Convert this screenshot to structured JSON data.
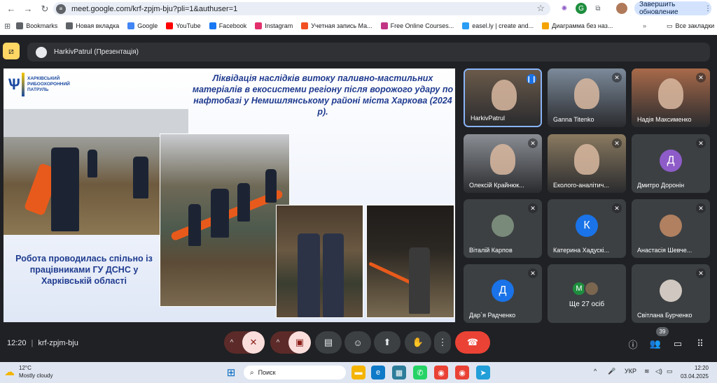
{
  "browser": {
    "url": "meet.google.com/krf-zpjm-bju?pli=1&authuser=1",
    "update_button": "Завершить обновление",
    "bookmarks": [
      {
        "label": "Bookmarks",
        "color": "#5f6368"
      },
      {
        "label": "Новая вкладка",
        "color": "#5f6368"
      },
      {
        "label": "Google",
        "color": "#4285f4"
      },
      {
        "label": "YouTube",
        "color": "#ff0000"
      },
      {
        "label": "Facebook",
        "color": "#1877f2"
      },
      {
        "label": "Instagram",
        "color": "#e1306c"
      },
      {
        "label": "Учетная запись Ма...",
        "color": "#f25022"
      },
      {
        "label": "Free Online Courses...",
        "color": "#c13584"
      },
      {
        "label": "easel.ly | create and...",
        "color": "#2a9df4"
      },
      {
        "label": "Диаграмма без наз...",
        "color": "#f4a300"
      }
    ],
    "all_bookmarks": "Все закладки"
  },
  "meet": {
    "presenter_label": "HarkivPatrul (Презентація)",
    "slide": {
      "org_name": "ХАРКІВСЬКИЙ РИБООХОРОННИЙ ПАТРУЛЬ",
      "title": "Ліквідація наслідків витоку паливно-мастильних матеріалів в екосистеми регіону після ворожого удару по нафтобазі у Немишлянському районі міста Харкова (2024 р).",
      "caption": "Робота проводилась спільно із працівниками ГУ ДСНС у Харківській області"
    },
    "participants": [
      {
        "name": "HarkivPatrul",
        "initial": "",
        "color": "#6a5a4a",
        "mic": "active"
      },
      {
        "name": "Ganna Titenko",
        "initial": "",
        "color": "#7c8a9a",
        "mic": "muted"
      },
      {
        "name": "Надія Максименко",
        "initial": "",
        "color": "#a86a4a",
        "mic": "muted"
      },
      {
        "name": "Олексій Крайнюк...",
        "initial": "",
        "color": "#8a8e94",
        "mic": "muted"
      },
      {
        "name": "Еколого-аналітич...",
        "initial": "",
        "color": "#8a7a60",
        "mic": "muted"
      },
      {
        "name": "Дмитро Доронін",
        "initial": "Д",
        "color": "#8e5cc8",
        "mic": "muted"
      },
      {
        "name": "Віталій Карпов",
        "initial": "",
        "color": "#7a8a7a",
        "mic": "muted"
      },
      {
        "name": "Катерина Хадускі...",
        "initial": "К",
        "color": "#1a73e8",
        "mic": "muted"
      },
      {
        "name": "Анастасія Шевче...",
        "initial": "",
        "color": "#b08060",
        "mic": "muted"
      },
      {
        "name": "Дар`я Радченко",
        "initial": "Д",
        "color": "#1a73e8",
        "mic": "muted"
      },
      {
        "name": "Ще 27 осіб",
        "initial": "М",
        "color": "#1e8e3e",
        "mic": "none"
      },
      {
        "name": "Світлана Бурченко",
        "initial": "",
        "color": "#d0c8c0",
        "mic": "muted"
      }
    ],
    "time": "12:20",
    "meeting_code": "krf-zpjm-bju",
    "participant_count": "39"
  },
  "taskbar": {
    "temperature": "12°C",
    "weather": "Mostly cloudy",
    "search_placeholder": "Поиск",
    "language": "УКР",
    "clock_time": "12:20",
    "clock_date": "03.04.2025"
  }
}
